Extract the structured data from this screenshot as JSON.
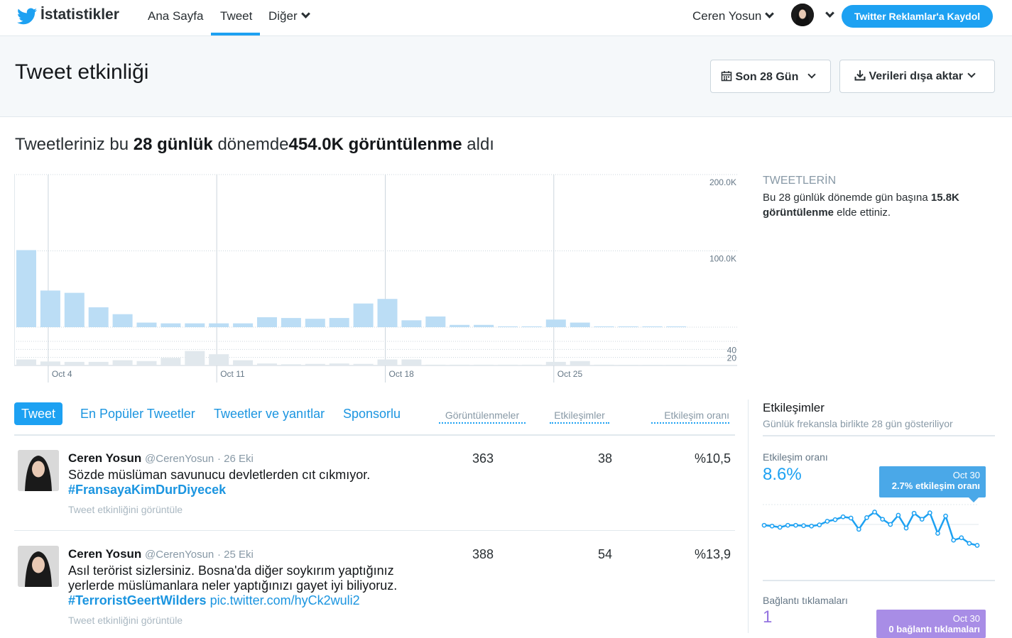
{
  "topbar": {
    "brand": "İstatistikler",
    "nav": [
      {
        "label": "Ana Sayfa"
      },
      {
        "label": "Tweet"
      },
      {
        "label": "Diğer"
      }
    ],
    "user_name": "Ceren Yosun",
    "ads_button": "Twitter Reklamlar'a Kaydol",
    "accent_color": "#1da1f2"
  },
  "header": {
    "title": "Tweet etkinliği",
    "date_range": "Son 28 Gün",
    "export": "Verileri dışa aktar"
  },
  "summary": {
    "prefix": "Tweetleriniz bu ",
    "period": "28 günlük",
    "middle": " dönemde",
    "impressions": "454.0K görüntülenme",
    "suffix": " aldı"
  },
  "chart_data": {
    "type": "bar",
    "categories": [
      "Oct 3",
      "Oct 4",
      "Oct 5",
      "Oct 6",
      "Oct 7",
      "Oct 8",
      "Oct 9",
      "Oct 10",
      "Oct 11",
      "Oct 12",
      "Oct 13",
      "Oct 14",
      "Oct 15",
      "Oct 16",
      "Oct 17",
      "Oct 18",
      "Oct 19",
      "Oct 20",
      "Oct 21",
      "Oct 22",
      "Oct 23",
      "Oct 24",
      "Oct 25",
      "Oct 26",
      "Oct 27",
      "Oct 28",
      "Oct 29",
      "Oct 30"
    ],
    "x_tick_labels": [
      "Oct 4",
      "Oct 11",
      "Oct 18",
      "Oct 25"
    ],
    "series": [
      {
        "values": [
          101,
          48,
          45,
          26,
          17,
          6,
          5,
          5,
          5,
          5,
          13,
          12,
          11,
          12,
          31,
          37,
          9,
          14,
          3,
          3,
          1,
          1,
          10,
          6,
          1,
          1,
          1,
          1
        ]
      },
      {
        "values": [
          15,
          10,
          9,
          9,
          13,
          11,
          19,
          36,
          28,
          13,
          5,
          3,
          4,
          5,
          4,
          15,
          15,
          2,
          2,
          2,
          2,
          2,
          9,
          11,
          2,
          1,
          1,
          1
        ]
      }
    ],
    "y_top_ticks": [
      "200.0K",
      "100.0K"
    ],
    "y_top_lim": [
      0,
      200000
    ],
    "y_bottom_ticks": [
      "40",
      "20"
    ],
    "y_bottom_lim": [
      0,
      60
    ],
    "top_color": "#bbddf5",
    "bottom_color": "#e1e8ed",
    "grid": true
  },
  "side": {
    "title": "TWEETLERİN",
    "desc_prefix": "Bu 28 günlük dönemde gün başına ",
    "desc_value": "15.8K görüntülenme",
    "desc_suffix": " elde ettiniz."
  },
  "tabs": [
    {
      "label": "Tweet"
    },
    {
      "label": "En Popüler Tweetler"
    },
    {
      "label": "Tweetler ve yanıtlar"
    },
    {
      "label": "Sponsorlu"
    }
  ],
  "columns": [
    "Görüntülenmeler",
    "Etkileşimler",
    "Etkileşim oranı"
  ],
  "tweets": [
    {
      "name": "Ceren Yosun",
      "handle": "@CerenYosun",
      "date": "· 26 Eki",
      "text": "Sözde müslüman savunucu devletlerden cıt cıkmıyor.",
      "hashtag": "#FransayaKimDurDiyecek",
      "link": "",
      "action": "Tweet etkinliğini görüntüle",
      "impressions": "363",
      "engagements": "38",
      "rate": "%10,5"
    },
    {
      "name": "Ceren Yosun",
      "handle": "@CerenYosun",
      "date": "· 25 Eki",
      "text": "Asıl terörist sizlersiniz. Bosna'da diğer soykırım yaptığınız yerlerde müslümanlara neler yaptığınızı gayet iyi biliyoruz.",
      "hashtag": "#TerroristGeertWilders",
      "link": "pic.twitter.com/hyCk2wuli2",
      "action": "Tweet etkinliğini görüntüle",
      "impressions": "388",
      "engagements": "54",
      "rate": "%13,9"
    }
  ],
  "engagement_panel": {
    "title": "Etkileşimler",
    "subtitle": "Günlük frekansla birlikte 28 gün gösteriliyor",
    "rate_label": "Etkileşim oranı",
    "rate_value": "8.6%",
    "rate_tooltip_date": "Oct 30",
    "rate_tooltip_value": "2.7% etkileşim oranı",
    "rate_color": "#1da1f2",
    "rate_series": [
      6.5,
      6.3,
      6.0,
      6.5,
      6.5,
      6.4,
      6.3,
      6.6,
      7.5,
      7.9,
      8.6,
      8.3,
      5.5,
      8.4,
      9.8,
      8.0,
      6.7,
      9.0,
      5.8,
      9.5,
      8.0,
      9.6,
      4.5,
      8.8,
      2.8,
      3.4,
      2.0,
      1.5
    ],
    "click_label": "Bağlantı tıklamaları",
    "click_value": "1",
    "click_tooltip_date": "Oct 30",
    "click_tooltip_value": "0 bağlantı tıklamaları",
    "click_color": "#9474e0"
  }
}
